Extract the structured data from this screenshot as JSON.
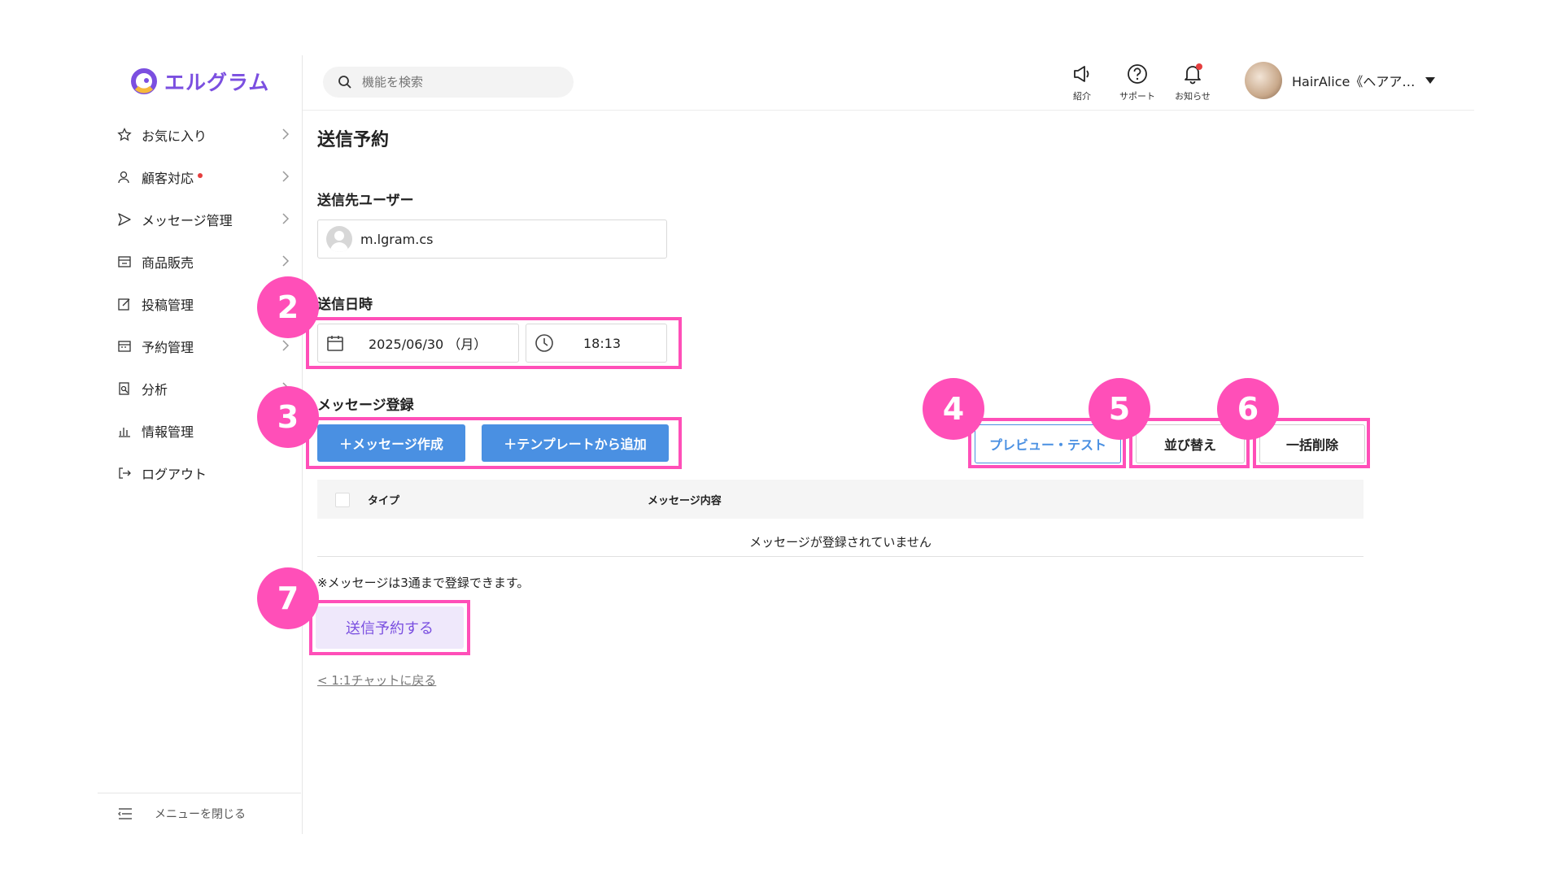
{
  "app": {
    "logo_text": "エルグラム"
  },
  "sidebar": {
    "items": [
      {
        "label": "お気に入り",
        "icon": "star-icon",
        "has_chevron": true,
        "dot": false
      },
      {
        "label": "顧客対応",
        "icon": "user-icon",
        "has_chevron": true,
        "dot": true
      },
      {
        "label": "メッセージ管理",
        "icon": "send-icon",
        "has_chevron": true,
        "dot": false
      },
      {
        "label": "商品販売",
        "icon": "store-icon",
        "has_chevron": true,
        "dot": false
      },
      {
        "label": "投稿管理",
        "icon": "edit-icon",
        "has_chevron": true,
        "dot": false
      },
      {
        "label": "予約管理",
        "icon": "calendar-icon",
        "has_chevron": true,
        "dot": false
      },
      {
        "label": "分析",
        "icon": "report-icon",
        "has_chevron": true,
        "dot": false
      },
      {
        "label": "情報管理",
        "icon": "bar-chart-icon",
        "has_chevron": false,
        "dot": false
      },
      {
        "label": "ログアウト",
        "icon": "logout-icon",
        "has_chevron": false,
        "dot": false
      }
    ],
    "close_menu_label": "メニューを閉じる"
  },
  "header": {
    "search_placeholder": "機能を検索",
    "icons": [
      {
        "label": "紹介",
        "icon": "megaphone-icon"
      },
      {
        "label": "サポート",
        "icon": "help-icon"
      },
      {
        "label": "お知らせ",
        "icon": "bell-icon"
      }
    ],
    "user_name": "HairAlice《ヘアア…"
  },
  "main": {
    "page_title": "送信予約",
    "recipient_label": "送信先ユーザー",
    "recipient_name": "m.lgram.cs",
    "datetime_label": "送信日時",
    "date_value": "2025/06/30 （月）",
    "time_value": "18:13",
    "message_label": "メッセージ登録",
    "create_button": "＋メッセージ作成",
    "template_button": "＋テンプレートから追加",
    "preview_button": "プレビュー・テスト",
    "sort_button": "並び替え",
    "delete_all_button": "一括削除",
    "table_columns": [
      "タイプ",
      "メッセージ内容"
    ],
    "empty_message": "メッセージが登録されていません",
    "note": "※メッセージは3通まで登録できます。",
    "submit_button": "送信予約する",
    "back_link": "< 1:1チャットに戻る"
  },
  "annotations": [
    "2",
    "3",
    "4",
    "5",
    "6",
    "7"
  ],
  "colors": {
    "accent_purple": "#7b4fe0",
    "button_blue": "#4a90e2",
    "highlight_pink": "#ff4fb8"
  }
}
